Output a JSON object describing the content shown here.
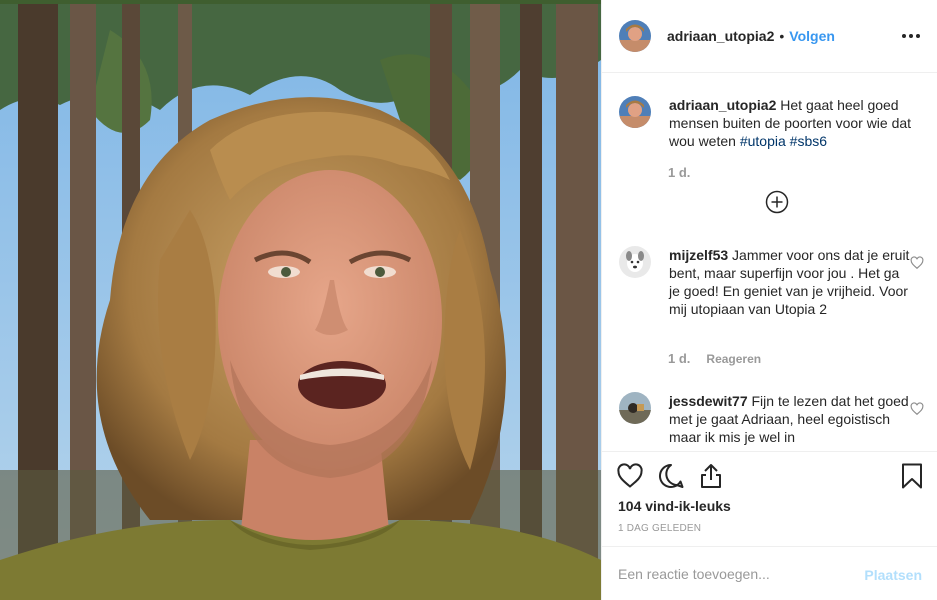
{
  "post": {
    "author": "adriaan_utopia2",
    "separator": "•",
    "follow_label": "Volgen",
    "more_icon": "more-horizontal-icon",
    "caption": {
      "username": "adriaan_utopia2",
      "text": "Het gaat heel goed mensen buiten de poorten voor wie dat wou weten ",
      "hashtags": [
        "#utopia",
        "#sbs6"
      ],
      "time": "1 d."
    },
    "load_more_icon": "plus-circle-icon",
    "comments": [
      {
        "username": "mijzelf53",
        "text": "Jammer voor ons dat je eruit bent, maar superfijn voor jou . Het ga je goed! En geniet van je vrijheid. Voor mij utopiaan van Utopia 2",
        "time": "1 d.",
        "reply_label": "Reageren",
        "avatar_icon": "dog-avatar-icon"
      },
      {
        "username": "jessdewit77",
        "text": "Fijn te lezen dat het goed met je gaat Adriaan, heel egoistisch maar ik mis je wel in",
        "avatar_icon": "beach-avatar-icon"
      }
    ],
    "actions": {
      "like_icon": "heart-icon",
      "comment_icon": "comment-icon",
      "share_icon": "share-icon",
      "save_icon": "bookmark-icon"
    },
    "likes": "104 vind-ik-leuks",
    "posted": "1 DAG GELEDEN",
    "add_comment": {
      "placeholder": "Een reactie toevoegen...",
      "post_label": "Plaatsen"
    }
  },
  "colors": {
    "link_blue": "#3897f0",
    "hashtag": "#003569",
    "muted": "#999999",
    "post_disabled": "#b2dffc"
  }
}
